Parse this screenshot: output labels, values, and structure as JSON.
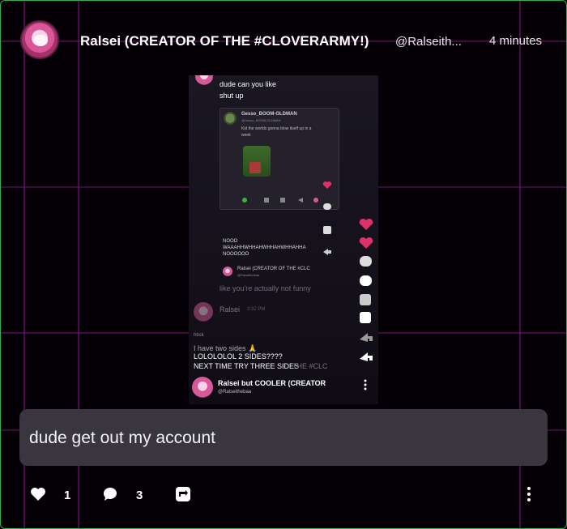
{
  "post": {
    "author": {
      "name": "Ralsei (CREATOR OF THE #CLOVERARMY!)",
      "handle": "@Ralseith..."
    },
    "timestamp": "4 minutes",
    "embedded_screenshot": {
      "top_message": "dude can you like",
      "top_message_2": "shut up",
      "quoted_post": {
        "author": "Gesso_BOOM-OLDMAN",
        "handle": "@Gesso_BOOM-OLDMAN",
        "text_1": "Kid the worlds gonna blow itself up in a",
        "text_2": "week",
        "reply_lines": [
          "NOOO",
          "WAAAHHWHHAHWHHAHWHHAHHA",
          "NOOOOOO"
        ],
        "reply_author": "Ralsei (CREATOR OF THE #CLC",
        "reply_handle": "@Ralseithebaa"
      },
      "middle_message": "like you're actually not funny",
      "ralsei_label": "Ralsei",
      "ralsei_time": "2:32 PM",
      "mid_small_1": "hbsk",
      "overlay_lines": [
        "I have two sides 🙏",
        "LOLOLOLOL 2 SIDES????",
        "NEXT TIME TRY THREE SIDES"
      ],
      "overlay_ghost": "THE #CLC",
      "bottom_author": "Ralsei but COOLER (CREATOR",
      "bottom_handle": "@Ralseithebaa"
    },
    "comment": {
      "text": "dude get out my account"
    },
    "footer": {
      "likes": "1",
      "comments": "3"
    }
  },
  "colors": {
    "border": "#2fae4a",
    "grid": "#8c148c",
    "comment_bg": "#3a3640",
    "heart_pink": "#e0306a"
  },
  "icons": [
    "heart-icon",
    "comment-icon",
    "repost-icon",
    "more-icon"
  ]
}
